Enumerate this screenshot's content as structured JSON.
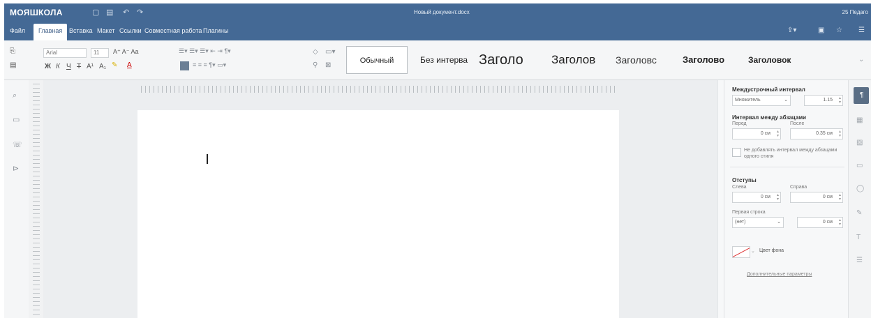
{
  "app": {
    "logo": "МОЯШКОЛА",
    "doc_title": "Новый документ.docx",
    "user": "25 Педаго"
  },
  "menu": {
    "items": [
      "Файл",
      "Главная",
      "Вставка",
      "Макет",
      "Ссылки",
      "Совместная работа",
      "Плагины"
    ],
    "active": "Главная"
  },
  "toolbar": {
    "font": "Arial",
    "size": "11"
  },
  "styles": [
    "Обычный",
    "Без интерва",
    "Заголо",
    "Заголов",
    "Заголовс",
    "Заголово",
    "Заголовок"
  ],
  "panel": {
    "line_spacing_label": "Междустрочный интервал",
    "line_spacing_mode": "Множитель",
    "line_spacing_value": "1.15",
    "para_spacing_label": "Интервал между абзацами",
    "before_label": "Перед",
    "after_label": "После",
    "before_value": "0 см",
    "after_value": "0.35 см",
    "no_spacing_checkbox": "Не добавлять интервал между абзацами одного стиля",
    "indents_label": "Отступы",
    "left_label": "Слева",
    "right_label": "Справа",
    "left_value": "0 см",
    "right_value": "0 см",
    "first_line_label": "Первая строка",
    "first_line_mode": "(нет)",
    "first_line_value": "0 см",
    "bg_color_label": "Цвет фона",
    "advanced_link": "Дополнительные параметры"
  }
}
